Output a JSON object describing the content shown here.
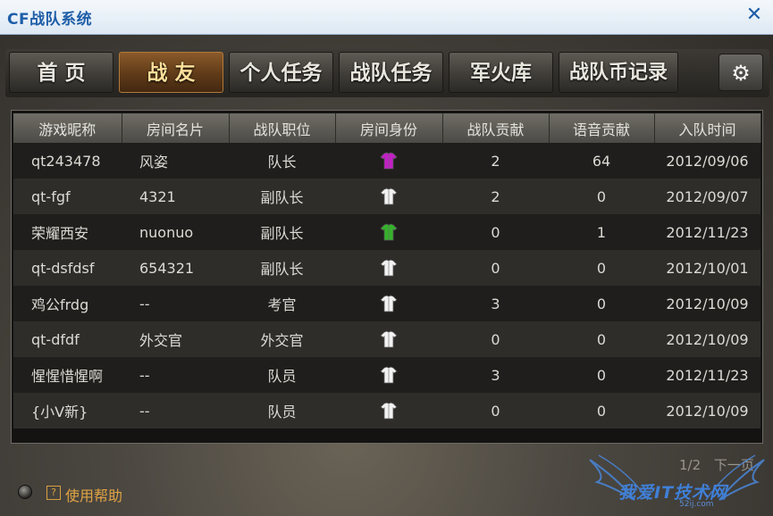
{
  "window": {
    "title": "CF战队系统",
    "close_glyph": "✕"
  },
  "tabs": [
    {
      "label": "首 页",
      "active": false
    },
    {
      "label": "战 友",
      "active": true
    },
    {
      "label": "个人任务",
      "active": false
    },
    {
      "label": "战队任务",
      "active": false
    },
    {
      "label": "军火库",
      "active": false
    },
    {
      "label": "战队币记录",
      "active": false
    }
  ],
  "settings_icon": "gear-icon",
  "table": {
    "columns": [
      "游戏昵称",
      "房间名片",
      "战队职位",
      "房间身份",
      "战队贡献",
      "语音贡献",
      "入队时间"
    ],
    "rows": [
      {
        "nickname": "qt243478",
        "card": "风姿",
        "position": "队长",
        "identity_icon": "purple-shirt-icon",
        "identity_color": "#c21fc6",
        "team_contrib": "2",
        "voice_contrib": "64",
        "join_date": "2012/09/06"
      },
      {
        "nickname": "qt-fgf",
        "card": "4321",
        "position": "副队长",
        "identity_icon": "white-shirt-icon",
        "identity_color": "#f2f2f2",
        "team_contrib": "2",
        "voice_contrib": "0",
        "join_date": "2012/09/07"
      },
      {
        "nickname": "荣耀西安",
        "card": "nuonuo",
        "position": "副队长",
        "identity_icon": "green-shirt-icon",
        "identity_color": "#35b22c",
        "team_contrib": "0",
        "voice_contrib": "1",
        "join_date": "2012/11/23"
      },
      {
        "nickname": "qt-dsfdsf",
        "card": "654321",
        "position": "副队长",
        "identity_icon": "white-shirt-icon",
        "identity_color": "#f2f2f2",
        "team_contrib": "0",
        "voice_contrib": "0",
        "join_date": "2012/10/01"
      },
      {
        "nickname": "鸡公frdg",
        "card": "--",
        "position": "考官",
        "identity_icon": "white-shirt-icon",
        "identity_color": "#f2f2f2",
        "team_contrib": "3",
        "voice_contrib": "0",
        "join_date": "2012/10/09"
      },
      {
        "nickname": "qt-dfdf",
        "card": "外交官",
        "position": "外交官",
        "identity_icon": "white-shirt-icon",
        "identity_color": "#f2f2f2",
        "team_contrib": "0",
        "voice_contrib": "0",
        "join_date": "2012/10/09"
      },
      {
        "nickname": "惺惺惜惺啊",
        "card": "--",
        "position": "队员",
        "identity_icon": "white-shirt-icon",
        "identity_color": "#f2f2f2",
        "team_contrib": "3",
        "voice_contrib": "0",
        "join_date": "2012/11/23"
      },
      {
        "nickname": "{小V新}",
        "card": "--",
        "position": "队员",
        "identity_icon": "white-shirt-icon",
        "identity_color": "#f2f2f2",
        "team_contrib": "0",
        "voice_contrib": "0",
        "join_date": "2012/10/09"
      }
    ]
  },
  "pager": {
    "page": "1/2",
    "next_label": "下一页"
  },
  "help": {
    "icon_glyph": "?",
    "label": "使用帮助"
  },
  "watermark": {
    "text": "我爱IT技术网",
    "sub": "52ij.com"
  }
}
